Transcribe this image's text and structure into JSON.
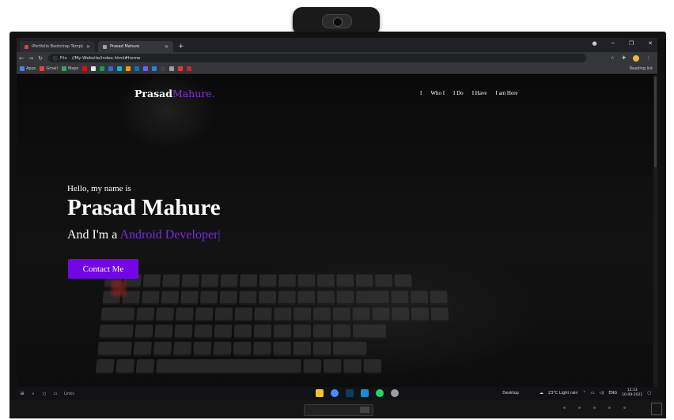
{
  "browser": {
    "tabs": [
      {
        "title": "iPortfolio Bootstrap Template - Index",
        "active": false
      },
      {
        "title": "Prasad Mahure",
        "active": true
      }
    ],
    "new_tab": "+",
    "address": {
      "scheme_label": "File",
      "url": "//My-Website/index.html#home"
    },
    "bookmarks": [
      {
        "label": "Apps",
        "color": "#4285f4"
      },
      {
        "label": "Gmail",
        "color": "#ea4335"
      },
      {
        "label": "Maps",
        "color": "#34a853"
      },
      {
        "label": "",
        "color": "#ff0000"
      },
      {
        "label": "",
        "color": "#e8e8e8"
      },
      {
        "label": "",
        "color": "#0f9d58"
      },
      {
        "label": "",
        "color": "#3367d6"
      },
      {
        "label": "",
        "color": "#00bcd4"
      },
      {
        "label": "",
        "color": "#ff9800"
      },
      {
        "label": "",
        "color": "#0077b5"
      },
      {
        "label": "",
        "color": "#6c63ff"
      },
      {
        "label": "",
        "color": "#1e88e5"
      },
      {
        "label": "",
        "color": "#424242"
      },
      {
        "label": "",
        "color": "#9e9e9e"
      },
      {
        "label": "",
        "color": "#e53935"
      },
      {
        "label": "",
        "color": "#c62828"
      }
    ],
    "reading_list": "Reading list"
  },
  "site": {
    "logo_main": "Prasad",
    "logo_accent": "Mahure.",
    "nav": [
      "I",
      "Who I",
      "I Do",
      "I Have",
      "I am Here"
    ],
    "greeting": "Hello, my name is",
    "name": "Prasad Mahure",
    "role_prefix": "And I'm a",
    "role_typed": "Android Developer",
    "cursor": "|",
    "cta": "Contact Me",
    "accent_color": "#7206e6"
  },
  "taskbar": {
    "search_placeholder": "Links",
    "apps": [
      "file-explorer",
      "chrome",
      "photoshop",
      "vscode",
      "whatsapp",
      "chrome-profile"
    ],
    "desktop_label": "Desktop",
    "weather": "23°C  Light rain",
    "language": "ENG",
    "time": "12:13",
    "date": "10-09-2021"
  }
}
